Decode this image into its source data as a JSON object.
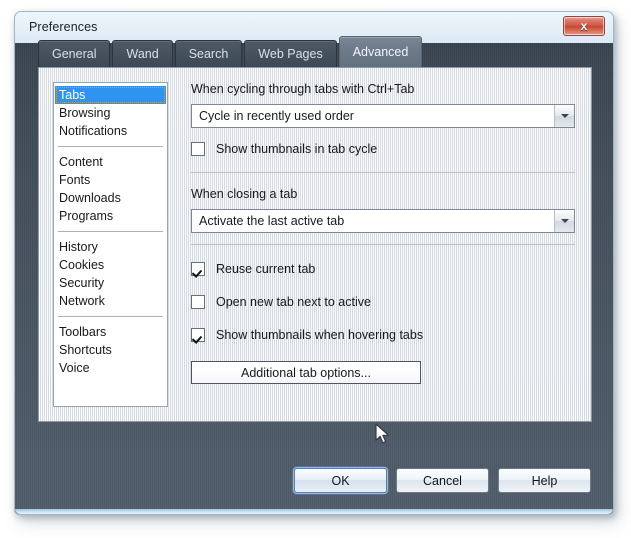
{
  "window": {
    "title": "Preferences",
    "close_icon": "close-icon",
    "close_glyph": "x"
  },
  "tabs": [
    {
      "label": "General",
      "selected": false
    },
    {
      "label": "Wand",
      "selected": false
    },
    {
      "label": "Search",
      "selected": false
    },
    {
      "label": "Web Pages",
      "selected": false
    },
    {
      "label": "Advanced",
      "selected": true
    }
  ],
  "sidebar": {
    "groups": [
      {
        "items": [
          {
            "label": "Tabs",
            "selected": true
          },
          {
            "label": "Browsing",
            "selected": false
          },
          {
            "label": "Notifications",
            "selected": false
          }
        ]
      },
      {
        "items": [
          {
            "label": "Content",
            "selected": false
          },
          {
            "label": "Fonts",
            "selected": false
          },
          {
            "label": "Downloads",
            "selected": false
          },
          {
            "label": "Programs",
            "selected": false
          }
        ]
      },
      {
        "items": [
          {
            "label": "History",
            "selected": false
          },
          {
            "label": "Cookies",
            "selected": false
          },
          {
            "label": "Security",
            "selected": false
          },
          {
            "label": "Network",
            "selected": false
          }
        ]
      },
      {
        "items": [
          {
            "label": "Toolbars",
            "selected": false
          },
          {
            "label": "Shortcuts",
            "selected": false
          },
          {
            "label": "Voice",
            "selected": false
          }
        ]
      }
    ]
  },
  "settings": {
    "cycling_label": "When cycling through tabs with Ctrl+Tab",
    "cycling_dropdown": {
      "value": "Cycle in recently used order",
      "arrow_icon": "chevron-down-icon"
    },
    "show_thumbs_cycle": {
      "label": "Show thumbnails in tab cycle",
      "checked": false
    },
    "closing_label": "When closing a tab",
    "closing_dropdown": {
      "value": "Activate the last active tab",
      "arrow_icon": "chevron-down-icon"
    },
    "reuse_current_tab": {
      "label": "Reuse current tab",
      "checked": true
    },
    "open_next_to_active": {
      "label": "Open new tab next to active",
      "checked": false
    },
    "show_thumbs_hover": {
      "label": "Show thumbnails when hovering tabs",
      "checked": true
    },
    "additional_button": "Additional tab options..."
  },
  "footer": {
    "ok": "OK",
    "cancel": "Cancel",
    "help": "Help"
  },
  "colors": {
    "selection_blue": "#2f94f0",
    "close_red": "#cf5340",
    "titlebar": "#e4eff8",
    "body_dark": "#4a5663",
    "panel": "#e3e7eb"
  },
  "cursor": {
    "icon": "mouse-pointer-icon"
  }
}
